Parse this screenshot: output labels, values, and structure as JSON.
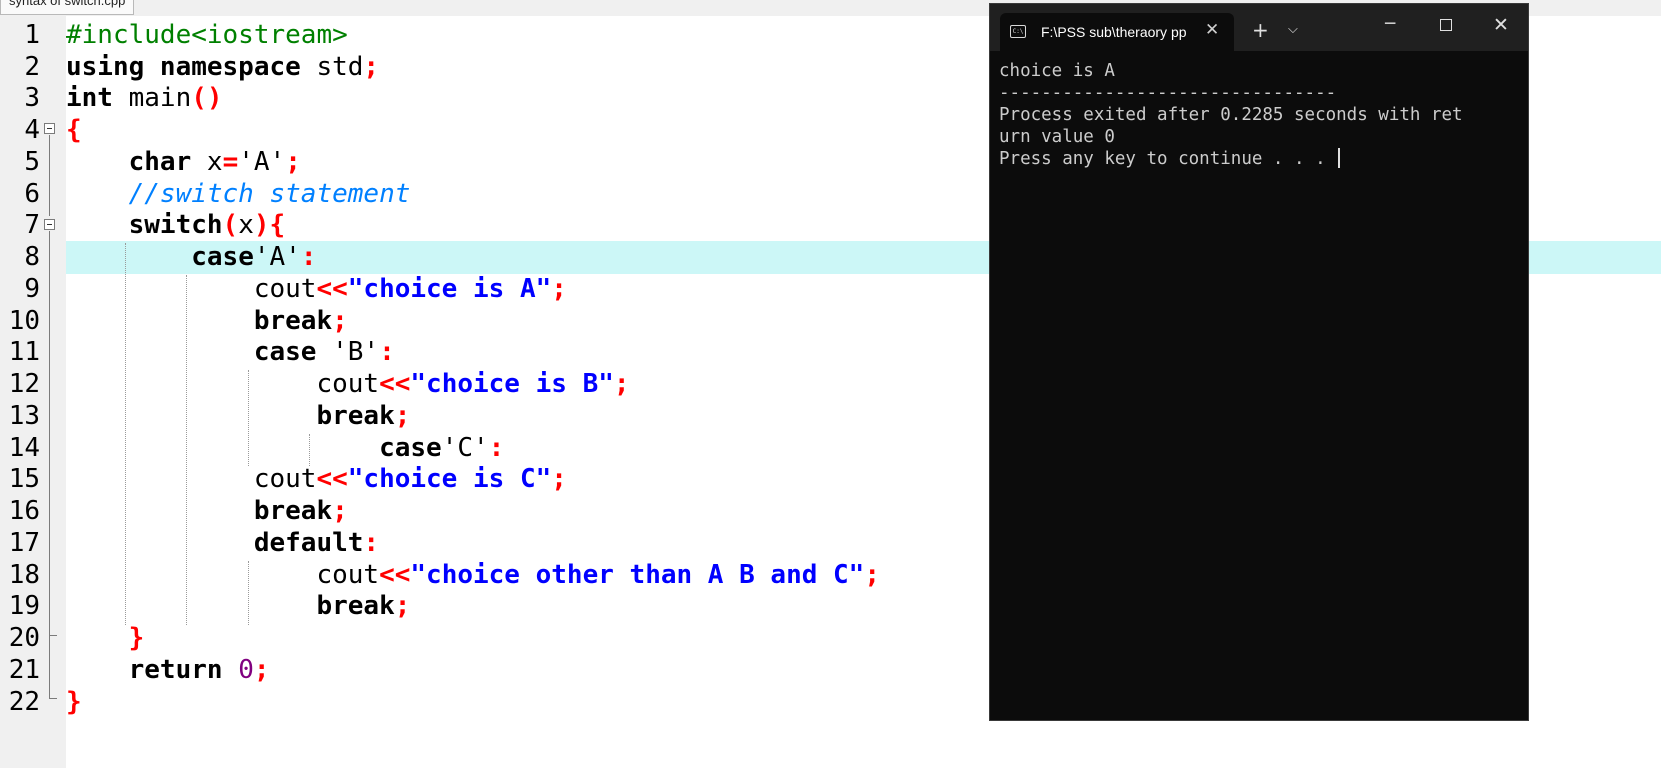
{
  "editor": {
    "tab_title": "syntax of switch.cpp",
    "line_numbers": [
      "1",
      "2",
      "3",
      "4",
      "5",
      "6",
      "7",
      "8",
      "9",
      "10",
      "11",
      "12",
      "13",
      "14",
      "15",
      "16",
      "17",
      "18",
      "19",
      "20",
      "21",
      "22"
    ],
    "lines": [
      [
        [
          "pp",
          "#include<iostream>"
        ]
      ],
      [
        [
          "kw",
          "using namespace "
        ],
        [
          "id",
          "std"
        ],
        [
          "op",
          ";"
        ]
      ],
      [
        [
          "kw",
          "int "
        ],
        [
          "id",
          "main"
        ],
        [
          "op",
          "()"
        ]
      ],
      [
        [
          "op",
          "{"
        ]
      ],
      [
        [
          "id",
          "    "
        ],
        [
          "kw",
          "char "
        ],
        [
          "id",
          "x"
        ],
        [
          "op",
          "="
        ],
        [
          "chr",
          "'A'"
        ],
        [
          "op",
          ";"
        ]
      ],
      [
        [
          "cm",
          "    //switch statement"
        ]
      ],
      [
        [
          "id",
          "    "
        ],
        [
          "kw",
          "switch"
        ],
        [
          "op",
          "("
        ],
        [
          "id",
          "x"
        ],
        [
          "op",
          "){"
        ]
      ],
      [
        [
          "id",
          "        "
        ],
        [
          "kw",
          "case"
        ],
        [
          "chr",
          "'A'"
        ],
        [
          "op",
          ":"
        ]
      ],
      [
        [
          "id",
          "            cout"
        ],
        [
          "op",
          "<<"
        ],
        [
          "str",
          "\"choice is A\""
        ],
        [
          "op",
          ";"
        ]
      ],
      [
        [
          "id",
          "            "
        ],
        [
          "kw",
          "break"
        ],
        [
          "op",
          ";"
        ]
      ],
      [
        [
          "id",
          "            "
        ],
        [
          "kw",
          "case "
        ],
        [
          "chr",
          "'B'"
        ],
        [
          "op",
          ":"
        ]
      ],
      [
        [
          "id",
          "                cout"
        ],
        [
          "op",
          "<<"
        ],
        [
          "str",
          "\"choice is B\""
        ],
        [
          "op",
          ";"
        ]
      ],
      [
        [
          "id",
          "                "
        ],
        [
          "kw",
          "break"
        ],
        [
          "op",
          ";"
        ]
      ],
      [
        [
          "id",
          "                    "
        ],
        [
          "kw",
          "case"
        ],
        [
          "chr",
          "'C'"
        ],
        [
          "op",
          ":"
        ]
      ],
      [
        [
          "id",
          "            cout"
        ],
        [
          "op",
          "<<"
        ],
        [
          "str",
          "\"choice is C\""
        ],
        [
          "op",
          ";"
        ]
      ],
      [
        [
          "id",
          "            "
        ],
        [
          "kw",
          "break"
        ],
        [
          "op",
          ";"
        ]
      ],
      [
        [
          "id",
          "            "
        ],
        [
          "kw",
          "default"
        ],
        [
          "op",
          ":"
        ]
      ],
      [
        [
          "id",
          "                cout"
        ],
        [
          "op",
          "<<"
        ],
        [
          "str",
          "\"choice other than A B and C\""
        ],
        [
          "op",
          ";"
        ]
      ],
      [
        [
          "id",
          "                "
        ],
        [
          "kw",
          "break"
        ],
        [
          "op",
          ";"
        ]
      ],
      [
        [
          "id",
          "    "
        ],
        [
          "op",
          "}"
        ]
      ],
      [
        [
          "id",
          "    "
        ],
        [
          "kw",
          "return "
        ],
        [
          "num",
          "0"
        ],
        [
          "op",
          ";"
        ]
      ],
      [
        [
          "op",
          "}"
        ]
      ]
    ]
  },
  "terminal": {
    "tab_title": "F:\\PSS sub\\theraory pp",
    "new_tab": "+",
    "output": [
      "choice is A",
      "--------------------------------",
      "Process exited after 0.2285 seconds with ret",
      "urn value 0",
      "Press any key to continue . . . "
    ]
  }
}
